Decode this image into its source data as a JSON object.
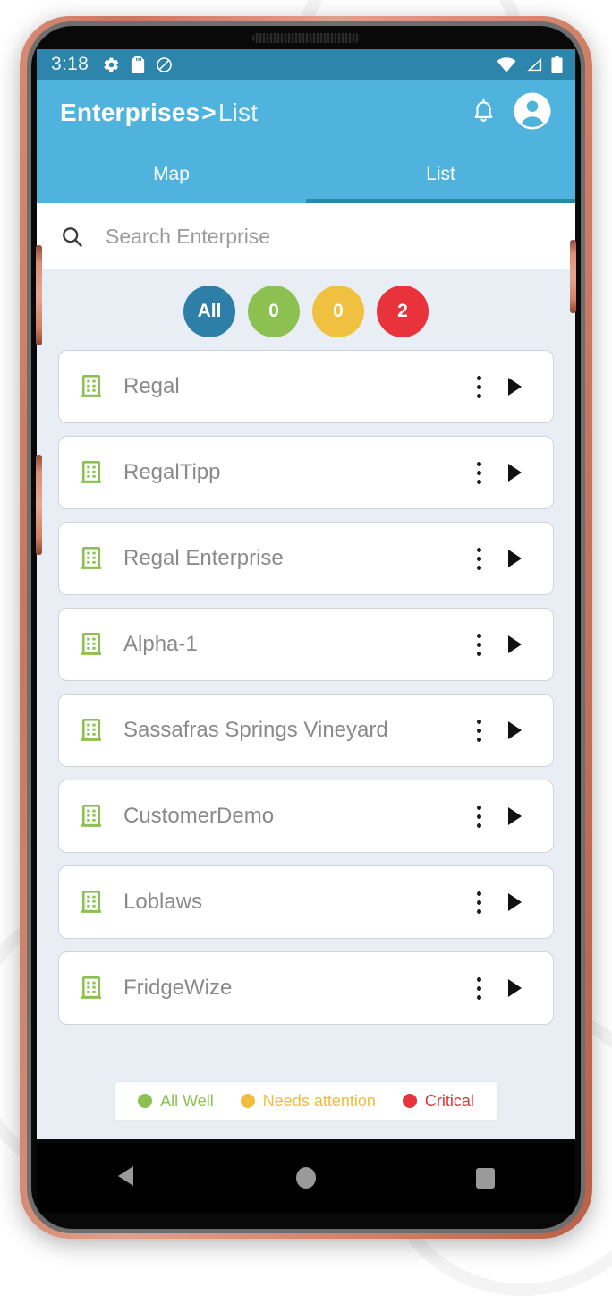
{
  "status_bar": {
    "time": "3:18",
    "left_icons": [
      "gear-icon",
      "sd-card-icon",
      "do-not-disturb-icon"
    ],
    "right_icons": [
      "wifi-icon",
      "cellular-signal-icon",
      "battery-icon"
    ]
  },
  "app_bar": {
    "title": "Enterprises",
    "separator": ">",
    "subtitle": "List",
    "notifications_icon": "bell-icon",
    "account_icon": "account-circle-icon",
    "background_color": "#4fb3dd"
  },
  "tabs": [
    {
      "label": "Map",
      "active": false
    },
    {
      "label": "List",
      "active": true
    }
  ],
  "search": {
    "placeholder": "Search Enterprise",
    "value": "",
    "icon": "search-icon"
  },
  "filters": [
    {
      "label": "All",
      "color": "#2e7fa8",
      "name": "filter-all"
    },
    {
      "label": "0",
      "color": "#8cc152",
      "name": "filter-all-well"
    },
    {
      "label": "0",
      "color": "#f0c040",
      "name": "filter-needs-attention"
    },
    {
      "label": "2",
      "color": "#e8323c",
      "name": "filter-critical"
    }
  ],
  "enterprises": [
    {
      "name": "Regal",
      "icon": "building-icon",
      "status_color": "#8cc152"
    },
    {
      "name": "RegalTipp",
      "icon": "building-icon",
      "status_color": "#8cc152"
    },
    {
      "name": "Regal Enterprise",
      "icon": "building-icon",
      "status_color": "#8cc152"
    },
    {
      "name": "Alpha-1",
      "icon": "building-icon",
      "status_color": "#8cc152"
    },
    {
      "name": "Sassafras Springs Vineyard",
      "icon": "building-icon",
      "status_color": "#8cc152"
    },
    {
      "name": "CustomerDemo",
      "icon": "building-icon",
      "status_color": "#8cc152"
    },
    {
      "name": "Loblaws",
      "icon": "building-icon",
      "status_color": "#8cc152"
    },
    {
      "name": "FridgeWize",
      "icon": "building-icon",
      "status_color": "#8cc152"
    }
  ],
  "legend": [
    {
      "label": "All Well",
      "color": "#8cc152"
    },
    {
      "label": "Needs attention",
      "color": "#f0bc3c"
    },
    {
      "label": "Critical",
      "color": "#e8323c"
    }
  ],
  "nav_bar": {
    "back": "back-triangle-icon",
    "home": "home-circle-icon",
    "recents": "recents-square-icon"
  }
}
